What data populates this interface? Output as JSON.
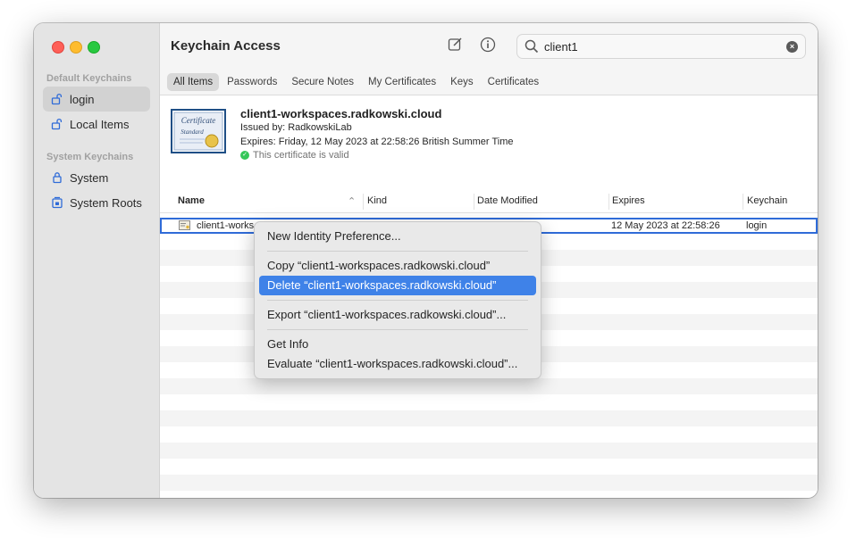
{
  "app": {
    "title": "Keychain Access"
  },
  "search": {
    "value": "client1",
    "clear_glyph": "×"
  },
  "toolbar": {
    "icons": [
      "compose-icon",
      "info-icon"
    ]
  },
  "tabs": [
    "All Items",
    "Passwords",
    "Secure Notes",
    "My Certificates",
    "Keys",
    "Certificates"
  ],
  "sidebar": {
    "sections": [
      {
        "label": "Default Keychains",
        "items": [
          {
            "label": "login",
            "icon": "unlocked-padlock-icon",
            "selected": true
          },
          {
            "label": "Local Items",
            "icon": "unlocked-padlock-icon",
            "selected": false
          }
        ]
      },
      {
        "label": "System Keychains",
        "items": [
          {
            "label": "System",
            "icon": "locked-padlock-icon",
            "selected": false
          },
          {
            "label": "System Roots",
            "icon": "cabinet-lock-icon",
            "selected": false
          }
        ]
      }
    ]
  },
  "certificate": {
    "name": "client1-workspaces.radkowski.cloud",
    "issued_by": "Issued by: RadkowskiLab",
    "expires": "Expires: Friday, 12 May 2023 at 22:58:26 British Summer Time",
    "status": "This certificate is valid",
    "badge_text_1": "Certificate",
    "badge_text_2": "Standard"
  },
  "table": {
    "columns": [
      "Name",
      "Kind",
      "Date Modified",
      "Expires",
      "Keychain"
    ],
    "rows": [
      {
        "name": "client1-works",
        "kind": "",
        "date_modified": "",
        "expires": "12 May 2023 at 22:58:26",
        "keychain": "login"
      }
    ]
  },
  "context_menu": {
    "items": [
      {
        "label": "New Identity Preference...",
        "highlighted": false
      },
      {
        "label": "Copy “client1-workspaces.radkowski.cloud”",
        "highlighted": false
      },
      {
        "label": "Delete “client1-workspaces.radkowski.cloud”",
        "highlighted": true
      },
      {
        "label": "Export “client1-workspaces.radkowski.cloud”...",
        "highlighted": false
      },
      {
        "label": "Get Info",
        "highlighted": false
      },
      {
        "label": "Evaluate “client1-workspaces.radkowski.cloud”...",
        "highlighted": false
      }
    ]
  },
  "colors": {
    "accent": "#3f82e8",
    "selection_border": "#2f6bd8",
    "valid": "#34c759"
  }
}
